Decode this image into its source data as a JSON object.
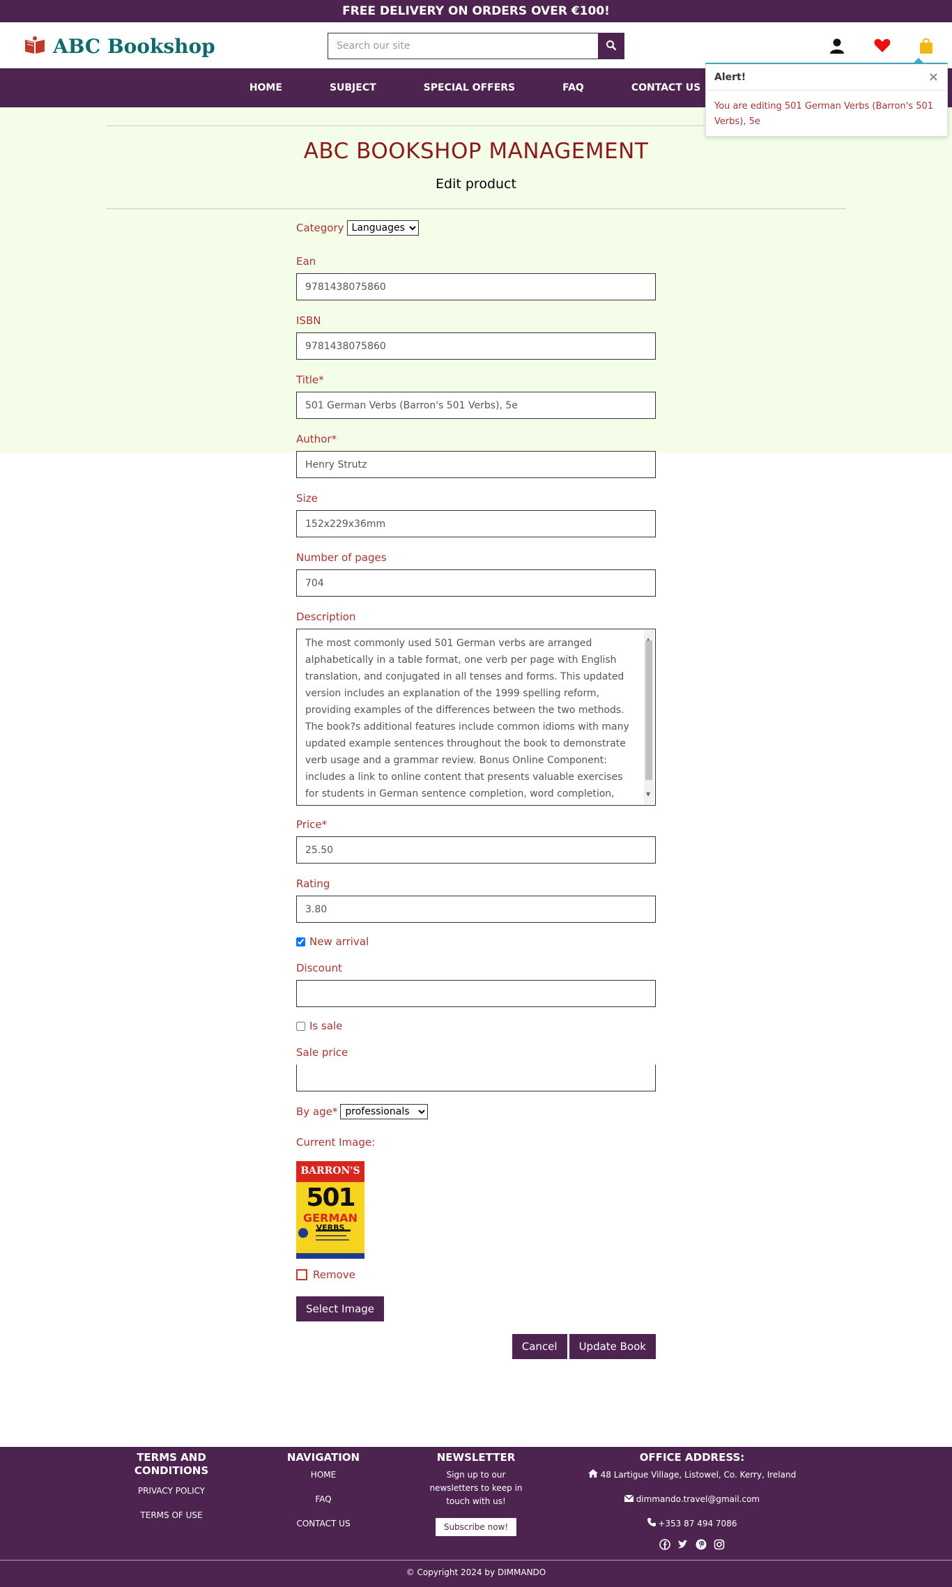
{
  "topbar": {
    "text": "FREE DELIVERY ON ORDERS OVER €100!"
  },
  "header": {
    "logo_name": "ABC Bookshop",
    "search_placeholder": "Search our site"
  },
  "nav": {
    "items": [
      "HOME",
      "SUBJECT",
      "SPECIAL OFFERS",
      "FAQ",
      "CONTACT US"
    ]
  },
  "alert": {
    "title": "Alert!",
    "close": "×",
    "message": "You are editing 501 German Verbs (Barron's 501 Verbs), 5e"
  },
  "page": {
    "title": "ABC BOOKSHOP MANAGEMENT",
    "subtitle": "Edit product"
  },
  "form": {
    "category_label": "Category",
    "category_value": "Languages",
    "ean_label": "Ean",
    "ean_value": "9781438075860",
    "isbn_label": "ISBN",
    "isbn_value": "9781438075860",
    "title_label": "Title*",
    "title_value": "501 German Verbs (Barron's 501 Verbs), 5e",
    "author_label": "Author*",
    "author_value": "Henry Strutz",
    "size_label": "Size",
    "size_value": "152x229x36mm",
    "pages_label": "Number of pages",
    "pages_value": "704",
    "description_label": "Description",
    "description_value": "The most commonly used 501 German verbs are arranged alphabetically in a table format, one verb per page with English translation, and conjugated in all tenses and forms. This updated version includes an explanation of the 1999 spelling reform, providing examples of the differences between the two methods. The book?s additional features include common idioms with many updated example sentences throughout the book to demonstrate verb usage and a grammar review. Bonus Online Component: includes a link to online content that presents valuable exercises for students in German sentence completion, word completion, word matching, and",
    "price_label": "Price*",
    "price_value": "25.50",
    "rating_label": "Rating",
    "rating_value": "3.80",
    "new_arrival_label": "New arrival",
    "discount_label": "Discount",
    "discount_value": "",
    "is_sale_label": "Is sale",
    "sale_price_label": "Sale price",
    "sale_price_value": "",
    "by_age_label": "By age*",
    "by_age_value": "professionals",
    "current_image_label": "Current Image:",
    "remove_label": "Remove",
    "select_image_label": "Select Image",
    "cancel_label": "Cancel",
    "update_label": "Update Book"
  },
  "book_cover": {
    "publisher": "BARRON'S",
    "number": "501",
    "line1": "GERMAN",
    "line2": "VERBS",
    "bg_color": "#f5d31f",
    "accent_color": "#d6261e"
  },
  "footer": {
    "terms_title": "TERMS AND CONDITIONS",
    "privacy": "PRIVACY POLICY",
    "terms_of_use": "TERMS OF USE",
    "navigation_title": "NAVIGATION",
    "nav_home": "HOME",
    "nav_faq": "FAQ",
    "nav_contact": "CONTACT US",
    "newsletter_title": "NEWSLETTER",
    "newsletter_text": "Sign up to our newsletters to keep in touch with us!",
    "subscribe": "Subscribe now!",
    "office_title": "OFFICE ADDRESS:",
    "address": "48 Lartigue Village, Listowel, Co. Kerry, Ireland",
    "email": "dimmando.travel@gmail.com",
    "phone": "+353 87 494 7086",
    "copyright": "© Copyright 2024 by DIMMANDO"
  },
  "colors": {
    "brand": "#4d2350",
    "label": "#a33535",
    "heading": "#8b1a1a",
    "admin_bg": "#f4fde8"
  },
  "icons": [
    "logo-book-icon",
    "search-icon",
    "user-icon",
    "heart-icon",
    "bag-icon",
    "home-icon",
    "envelope-icon",
    "phone-icon",
    "facebook-icon",
    "twitter-icon",
    "pinterest-icon",
    "instagram-icon"
  ]
}
